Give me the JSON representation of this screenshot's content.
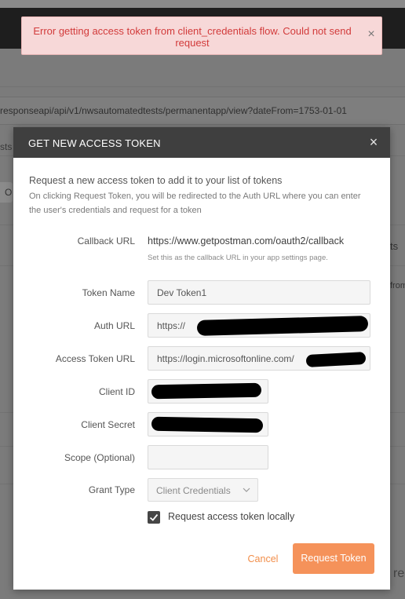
{
  "toast": {
    "message": "Error getting access token from client_credentials flow. Could not send request",
    "close_glyph": "×",
    "text_color": "#d23b3b",
    "bg_color": "#f7d8d8"
  },
  "background": {
    "url_text": "responseapi/api/v1/nwsautomatedtests/permanentapp/view?dateFrom=1753-01-01",
    "frag_sts": "sts",
    "frag_o": "O",
    "frag_ts": "ts",
    "frag_from": "from",
    "frag_re": "re"
  },
  "modal": {
    "title": "GET NEW ACCESS TOKEN",
    "close_glyph": "×",
    "intro": "Request a new access token to add it to your list of tokens",
    "intro_desc": "On clicking Request Token, you will be redirected to the Auth URL where you can enter the user's credentials and request for a token",
    "callback": {
      "label": "Callback URL",
      "value": "https://www.getpostman.com/oauth2/callback",
      "hint": "Set this as the callback URL in your app settings page."
    },
    "token_name": {
      "label": "Token Name",
      "value": "Dev Token1"
    },
    "auth_url": {
      "label": "Auth URL",
      "value": "https://"
    },
    "access_token_url": {
      "label": "Access Token URL",
      "value": "https://login.microsoftonline.com/"
    },
    "client_id": {
      "label": "Client ID",
      "value": ""
    },
    "client_secret": {
      "label": "Client Secret",
      "value": ""
    },
    "scope": {
      "label": "Scope (Optional)",
      "value": ""
    },
    "grant_type": {
      "label": "Grant Type",
      "selected": "Client Credentials"
    },
    "local_checkbox": {
      "label": "Request access token locally",
      "checked": true
    },
    "cancel_label": "Cancel",
    "request_label": "Request Token",
    "accent_color": "#f5925a",
    "header_color": "#3f3f3f"
  }
}
